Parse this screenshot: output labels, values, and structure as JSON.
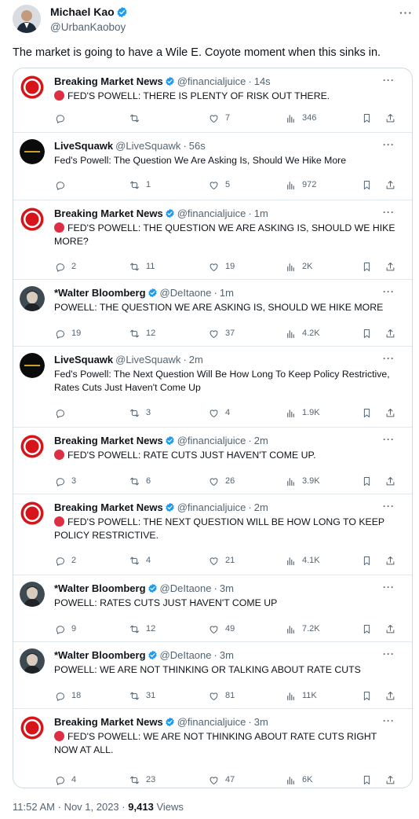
{
  "post": {
    "author_name": "Michael Kao",
    "author_handle": "@UrbanKaoboy",
    "text": "The market is going to have a Wile E. Coyote moment when this sinks in.",
    "time": "11:52 AM",
    "date": "Nov 1, 2023",
    "separator": "·",
    "views_count": "9,413",
    "views_label": "Views",
    "more_glyph": "···"
  },
  "colors": {
    "verified": "#1d9bf0",
    "red_dot": "#dd2e44",
    "secondary_text": "#536471",
    "border": "#cfd9de"
  },
  "tweets": [
    {
      "name": "Breaking Market News",
      "verified": true,
      "handle": "@financialjuice",
      "time": "14s",
      "red_dot": true,
      "text": "FED'S POWELL: THERE IS PLENTY OF RISK OUT THERE.",
      "replies": "",
      "retweets": "",
      "likes": "7",
      "views": "346"
    },
    {
      "name": "LiveSquawk",
      "verified": false,
      "handle": "@LiveSquawk",
      "time": "56s",
      "red_dot": false,
      "text": "Fed's Powell: The Question We Are Asking Is, Should We Hike More",
      "replies": "",
      "retweets": "1",
      "likes": "5",
      "views": "972"
    },
    {
      "name": "Breaking Market News",
      "verified": true,
      "handle": "@financialjuice",
      "time": "1m",
      "red_dot": true,
      "text": "FED'S POWELL: THE QUESTION WE ARE ASKING IS, SHOULD WE HIKE MORE?",
      "replies": "2",
      "retweets": "11",
      "likes": "19",
      "views": "2K"
    },
    {
      "name": "*Walter Bloomberg",
      "verified": true,
      "handle": "@DeItaone",
      "time": "1m",
      "red_dot": false,
      "text": "POWELL: THE QUESTION WE ARE ASKING IS, SHOULD WE HIKE MORE",
      "replies": "19",
      "retweets": "12",
      "likes": "37",
      "views": "4.2K"
    },
    {
      "name": "LiveSquawk",
      "verified": false,
      "handle": "@LiveSquawk",
      "time": "2m",
      "red_dot": false,
      "text": "Fed's Powell: The Next Question Will Be How Long To Keep Policy Restrictive, Rates Cuts Just Haven't Come Up",
      "replies": "",
      "retweets": "3",
      "likes": "4",
      "views": "1.9K"
    },
    {
      "name": "Breaking Market News",
      "verified": true,
      "handle": "@financialjuice",
      "time": "2m",
      "red_dot": true,
      "text": "FED'S POWELL: RATE CUTS JUST HAVEN'T COME UP.",
      "replies": "3",
      "retweets": "6",
      "likes": "26",
      "views": "3.9K"
    },
    {
      "name": "Breaking Market News",
      "verified": true,
      "handle": "@financialjuice",
      "time": "2m",
      "red_dot": true,
      "text": "FED'S POWELL: THE NEXT QUESTION WILL BE HOW LONG TO KEEP POLICY RESTRICTIVE.",
      "replies": "2",
      "retweets": "4",
      "likes": "21",
      "views": "4.1K"
    },
    {
      "name": "*Walter Bloomberg",
      "verified": true,
      "handle": "@DeItaone",
      "time": "3m",
      "red_dot": false,
      "text": "POWELL: RATES CUTS JUST HAVEN'T COME UP",
      "replies": "9",
      "retweets": "12",
      "likes": "49",
      "views": "7.2K"
    },
    {
      "name": "*Walter Bloomberg",
      "verified": true,
      "handle": "@DeItaone",
      "time": "3m",
      "red_dot": false,
      "text": "POWELL: WE ARE NOT THINKING OR TALKING ABOUT RATE CUTS",
      "replies": "18",
      "retweets": "31",
      "likes": "81",
      "views": "11K"
    },
    {
      "name": "Breaking Market News",
      "verified": true,
      "handle": "@financialjuice",
      "time": "3m",
      "red_dot": true,
      "text": "FED'S POWELL:  WE ARE NOT THINKING ABOUT RATE CUTS RIGHT NOW AT ALL.",
      "replies": "4",
      "retweets": "23",
      "likes": "47",
      "views": "6K"
    }
  ]
}
